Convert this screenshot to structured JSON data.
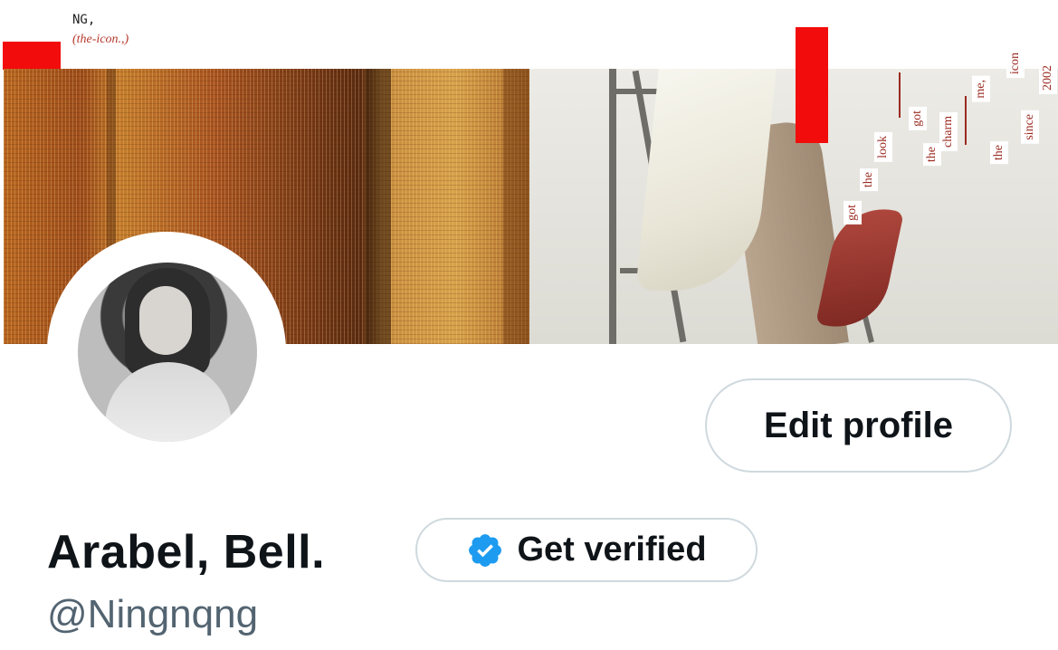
{
  "cover": {
    "top_label": "NG,",
    "top_sub": "(the-icon.,)",
    "stair_words": [
      "got",
      "the",
      "look",
      "got",
      "the",
      "charm",
      "me,",
      "the",
      "icon",
      "since",
      "2002"
    ]
  },
  "profile": {
    "display_name": "Arabel, Bell.",
    "handle": "@Ningnqng"
  },
  "actions": {
    "edit_profile_label": "Edit profile",
    "get_verified_label": "Get verified"
  },
  "icons": {
    "verified_badge": "verified-badge-icon"
  },
  "colors": {
    "accent_red": "#f20c0c",
    "verified_blue": "#1d9bf0",
    "text_primary": "#0f1419",
    "text_secondary": "#536471",
    "button_border": "#cfd9de"
  }
}
